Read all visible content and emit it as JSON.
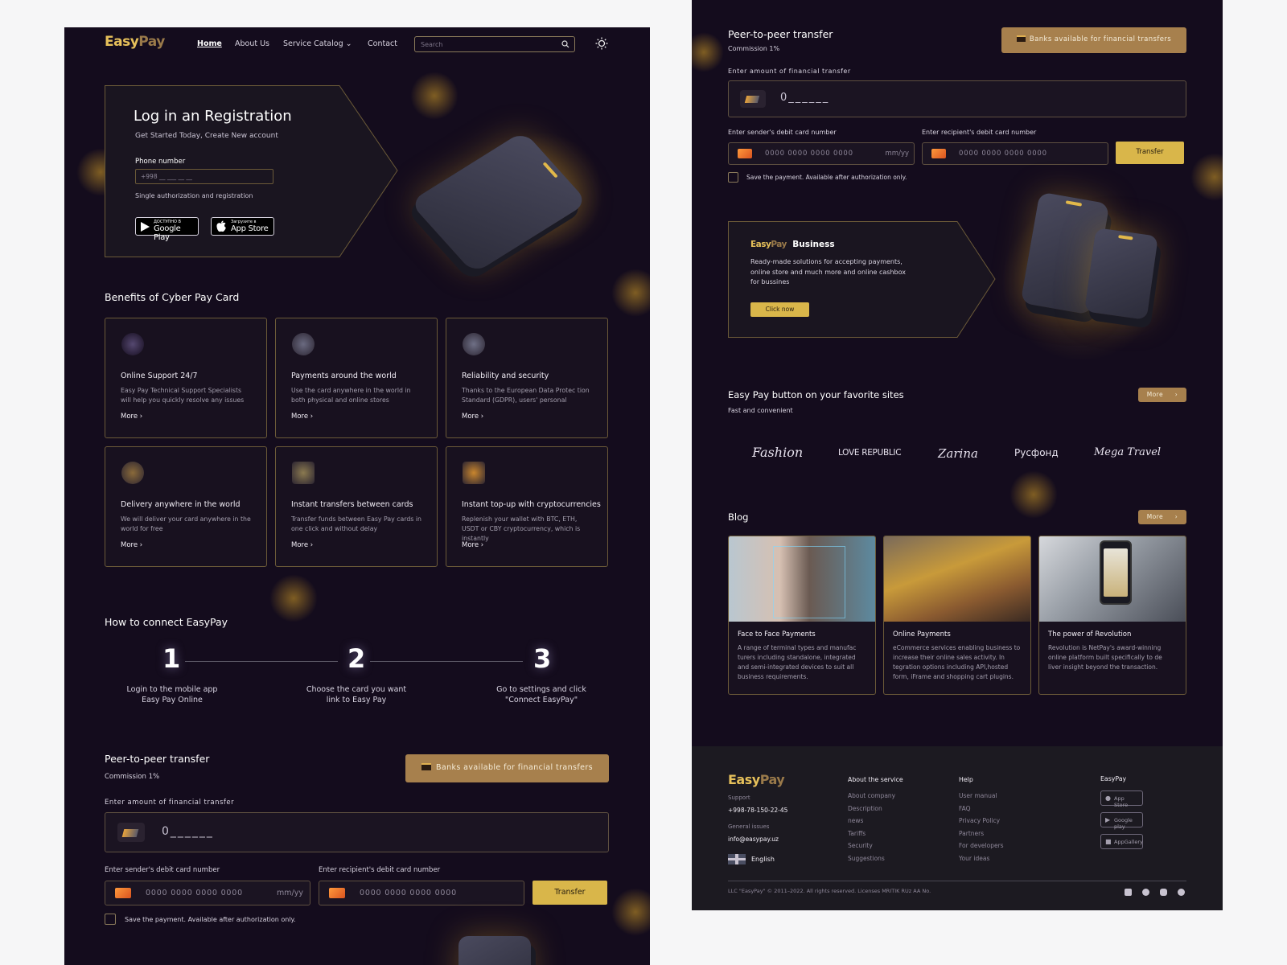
{
  "brand": {
    "easy": "Easy",
    "pay": "Pay"
  },
  "nav": {
    "home": "Home",
    "about": "About Us",
    "catalog": "Service Catalog",
    "contact": "Contact"
  },
  "search": {
    "placeholder": "Search"
  },
  "hero": {
    "title": "Log in an Registration",
    "subtitle": "Get Started Today, Create New account",
    "phone_label": "Phone number",
    "phone_placeholder": "+998 __ ___ __ __",
    "hint": "Single authorization and registration",
    "google_small": "ДОСТУПНО В",
    "google_big": "Google Play",
    "apple_small": "Загрузите в",
    "apple_big": "App Store"
  },
  "benefits": {
    "title": "Benefits of Cyber Pay Card",
    "more": "More",
    "items": [
      {
        "title": "Online Support 24/7",
        "desc": "Easy Pay Technical Support Specialists will help you quickly resolve any issues",
        "icon": "headset-icon"
      },
      {
        "title": "Payments around the world",
        "desc": "Use the card anywhere in the world in both physical and online stores",
        "icon": "globe-icon"
      },
      {
        "title": "Reliability and security",
        "desc": "Thanks to the European Data Protec tion Standard (GDPR), users' personal",
        "icon": "shield-icon"
      },
      {
        "title": "Delivery anywhere in the world",
        "desc": "We will deliver your card anywhere in the world for free",
        "icon": "rocket-icon"
      },
      {
        "title": "Instant transfers between cards",
        "desc": "Transfer funds between Easy Pay cards in one click and without delay",
        "icon": "cards-icon"
      },
      {
        "title": "Instant top-up with cryptocurrencies",
        "desc": "Replenish your wallet with BTC, ETH, USDT or CBY cryptocurrency, which is instantly",
        "icon": "wallet-icon"
      }
    ]
  },
  "connect": {
    "title": "How to connect EasyPay",
    "steps": [
      {
        "num": "1",
        "l1": "Login to the mobile app",
        "l2": "Easy Pay Online"
      },
      {
        "num": "2",
        "l1": "Choose the card you want",
        "l2": "link to Easy Pay"
      },
      {
        "num": "3",
        "l1": "Go to settings and click",
        "l2": "\"Connect EasyPay\""
      }
    ]
  },
  "p2p": {
    "title": "Peer-to-peer transfer",
    "commission": "Commission 1%",
    "banks_btn": "Banks available for financial transfers",
    "amount_label": "Enter amount of financial transfer",
    "amount_placeholder": "0______",
    "sender_label": "Enter sender's debit card number",
    "recipient_label": "Enter recipient's debit card number",
    "card_placeholder": "0000 0000 0000 0000",
    "expiry_placeholder": "mm/yy",
    "transfer_btn": "Transfer",
    "save_text": "Save the payment. Available after authorization only."
  },
  "business": {
    "brand_easy": "Easy",
    "brand_pay": "Pay",
    "title": "Business",
    "desc": "Ready-made solutions for accepting payments, online store and much more and online cashbox for bussines",
    "btn": "Click now"
  },
  "sites": {
    "title": "Easy Pay button on your favorite sites",
    "subtitle": "Fast and convenient",
    "more": "More",
    "brands": [
      "Fashion",
      "LOVE REPUBLIC",
      "Zarina",
      "Русфонд",
      "Mega Travel"
    ]
  },
  "blog": {
    "title": "Blog",
    "more": "More",
    "posts": [
      {
        "title": "Face to Face Payments",
        "desc": "A range of terminal types and manufac turers including standalone, integrated and semi-integrated devices to suit all business requirements."
      },
      {
        "title": "Online Payments",
        "desc": "eCommerce services enabling business to increase their online sales activity. In tegration options including API,hosted form, iFrame and shopping cart plugins."
      },
      {
        "title": "The power of Revolution",
        "desc": "Revolution is NetPay's award-winning online platform built specifically to de liver insight beyond the transaction."
      }
    ]
  },
  "footer": {
    "support_label": "Support",
    "phone": "+998-78-150-22-45",
    "general_label": "General issues",
    "email": "info@easypay.uz",
    "language": "English",
    "about_head": "About the service",
    "about_links": [
      "About company",
      "Description",
      "news",
      "Tariffs",
      "Security",
      "Suggestions"
    ],
    "help_head": "Help",
    "help_links": [
      "User manual",
      "FAQ",
      "Privacy Policy",
      "Partners",
      "For developers",
      "Your ideas"
    ],
    "app_head": "EasyPay",
    "apps": [
      "App Store",
      "Google play",
      "AppGallery"
    ],
    "copyright": "LLC \"EasyPay\" © 2011–2022. All rights reserved. Licenses MRITIK RUz AA No."
  },
  "colors": {
    "background": "#140c1d",
    "gold": "#d9b64a",
    "bronze": "#a7804d"
  }
}
